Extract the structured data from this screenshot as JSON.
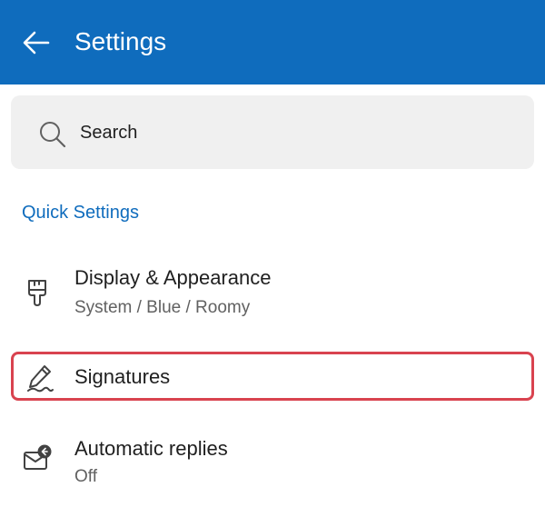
{
  "header": {
    "title": "Settings",
    "back_icon": "arrow-left-icon",
    "background": "#0f6cbd"
  },
  "search": {
    "label": "Search",
    "icon": "search-icon"
  },
  "section": {
    "title": "Quick Settings",
    "color": "#0f6cbd"
  },
  "items": [
    {
      "title": "Display & Appearance",
      "subtitle": "System / Blue / Roomy",
      "icon": "paintbrush-icon"
    },
    {
      "title": "Signatures",
      "subtitle": "",
      "icon": "signature-pen-icon",
      "highlighted": true,
      "highlight_color": "#d9434f"
    },
    {
      "title": "Automatic replies",
      "subtitle": "Off",
      "icon": "auto-reply-envelope-icon"
    }
  ]
}
